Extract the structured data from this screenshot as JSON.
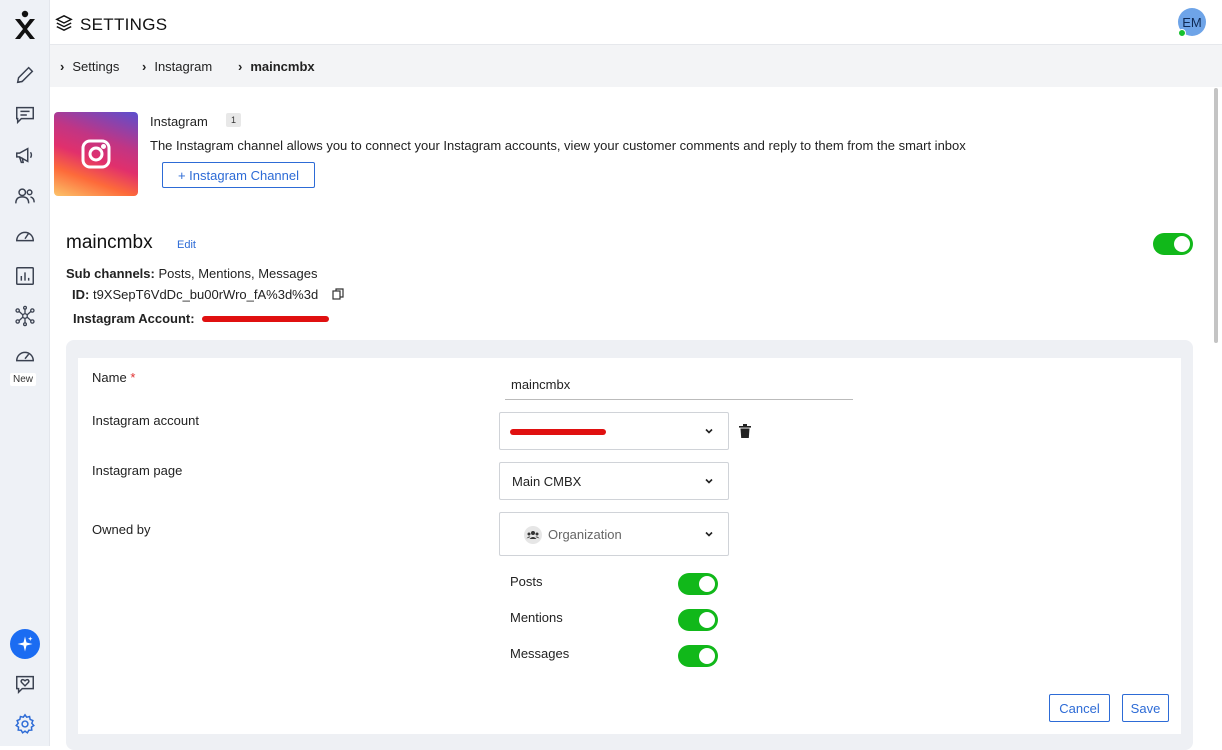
{
  "header": {
    "title": "SETTINGS",
    "avatar_initials": "EM"
  },
  "sidebar": {
    "new_badge": "New"
  },
  "breadcrumb": {
    "items": [
      "Settings",
      "Instagram",
      "maincmbx"
    ]
  },
  "channel": {
    "name": "Instagram",
    "count": "1",
    "description": "The Instagram channel allows you to connect your Instagram accounts, view your customer comments and reply to them from the smart inbox",
    "add_button": "+ Instagram Channel"
  },
  "account": {
    "name": "maincmbx",
    "edit_label": "Edit",
    "enabled": true,
    "sub_channels_label": "Sub channels:",
    "sub_channels_value": "Posts, Mentions, Messages",
    "id_label": "ID:",
    "id_value": "t9XSepT6VdDc_bu00rWro_fA%3d%3d",
    "ig_account_label": "Instagram Account:"
  },
  "form": {
    "name_label": "Name",
    "name_required": "*",
    "name_value": "maincmbx",
    "ig_account_label": "Instagram account",
    "ig_page_label": "Instagram page",
    "ig_page_value": "Main CMBX",
    "owned_by_label": "Owned by",
    "owned_by_value": "Organization",
    "switches": [
      {
        "label": "Posts",
        "on": true
      },
      {
        "label": "Mentions",
        "on": true
      },
      {
        "label": "Messages",
        "on": true
      }
    ],
    "cancel_label": "Cancel",
    "save_label": "Save"
  },
  "colors": {
    "accent": "#2d6bd6",
    "toggle_on": "#11b81a",
    "sidebar_bg": "#eef1f6",
    "redaction": "#e01010"
  }
}
